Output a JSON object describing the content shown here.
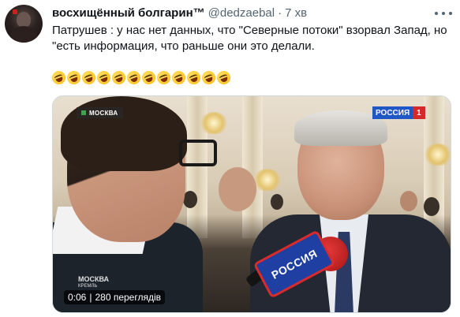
{
  "author": {
    "display_name": "восхищённый болгарин™",
    "handle": "@dedzaebal",
    "separator": "·",
    "time": "7 хв"
  },
  "tweet": {
    "text": "Патрушев : у нас нет данных, что \"Северные потоки\" взорвал Запад, но \"есть информация, что раньше они это делали.",
    "emoji": [
      "🤣",
      "🤣",
      "🤣",
      "🤣",
      "🤣",
      "🤣",
      "🤣",
      "🤣",
      "🤣",
      "🤣",
      "🤣",
      "🤣"
    ]
  },
  "video": {
    "location_bug": "МОСКВА",
    "channel_name": "РОССИЯ",
    "channel_number": "1",
    "watermark_line1": "МОСКВА",
    "watermark_line2": "КРЕМЛЬ",
    "mic_text": "РОССИЯ",
    "duration": "0:06",
    "stats_separator": "|",
    "views": "280 переглядів"
  },
  "colors": {
    "text_primary": "#0f1419",
    "text_secondary": "#536471",
    "channel_blue": "#1f57c4",
    "channel_red": "#d62828"
  }
}
